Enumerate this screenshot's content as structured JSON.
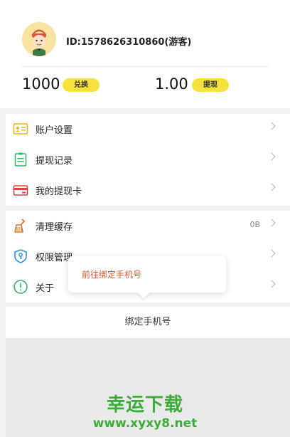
{
  "profile": {
    "id_text": "ID:1578626310860(游客)"
  },
  "coins": {
    "value": "1000",
    "button_label": "兑换"
  },
  "balance": {
    "value": "1.00",
    "button_label": "提现"
  },
  "menu_group1": [
    {
      "label": "账户设置",
      "icon": "id-card-icon"
    },
    {
      "label": "提现记录",
      "icon": "clipboard-icon"
    },
    {
      "label": "我的提现卡",
      "icon": "card-icon"
    }
  ],
  "menu_group2": [
    {
      "label": "清理缓存",
      "value": "0B",
      "icon": "broom-icon"
    },
    {
      "label": "权限管理",
      "icon": "shield-key-icon"
    },
    {
      "label": "关于",
      "icon": "info-circle-icon"
    }
  ],
  "popup": {
    "text": "前往绑定手机号"
  },
  "bind_phone": {
    "label": "绑定手机号"
  },
  "watermark": {
    "title": "幸运下载",
    "url": "www.xyxy8.net"
  },
  "colors": {
    "accent_yellow": "#f7e23c",
    "popup_text": "#d6582e",
    "watermark_green": "#3dac3a"
  }
}
